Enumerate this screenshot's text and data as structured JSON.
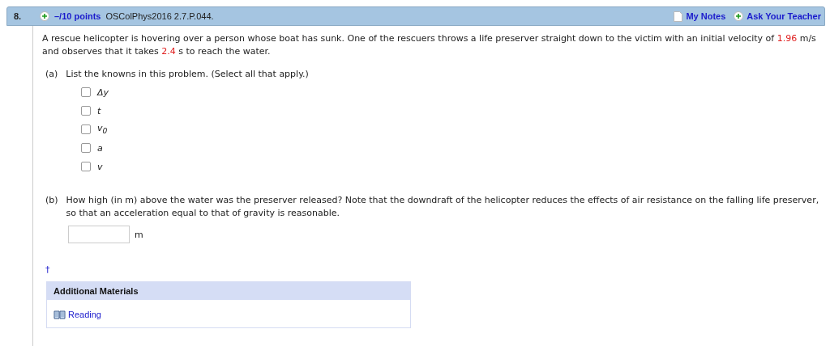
{
  "question": {
    "number": "8.",
    "points": "–/10 points",
    "source": "OSColPhys2016 2.7.P.044.",
    "notes_link": "My Notes",
    "ask_link": "Ask Your Teacher"
  },
  "prompt": [
    {
      "kind": "text",
      "text": "A rescue helicopter is hovering over a person whose boat has sunk. One of the rescuers throws a life preserver straight down to the victim with an initial velocity of "
    },
    {
      "kind": "value",
      "text": "1.96"
    },
    {
      "kind": "text",
      "text": " m/s and observes that it takes "
    },
    {
      "kind": "value",
      "text": "2.4"
    },
    {
      "kind": "text",
      "text": " s to reach the water."
    }
  ],
  "part_a": {
    "label": "(a)",
    "text": "List the knowns in this problem. (Select all that apply.)",
    "options": [
      {
        "label": "Δy",
        "checked": false
      },
      {
        "label": "t",
        "checked": false
      },
      {
        "label": "v$_{0}$",
        "checked": false
      },
      {
        "label": "a",
        "checked": false
      },
      {
        "label": "v",
        "checked": false
      }
    ]
  },
  "part_b": {
    "label": "(b)",
    "text": "How high (in m) above the water was the preserver released? Note that the downdraft of the helicopter reduces the effects of air resistance on the falling life preserver, so that an acceleration equal to that of gravity is reasonable.",
    "unit": "m"
  },
  "dagger": "†",
  "additional": {
    "title": "Additional Materials",
    "link": "Reading"
  }
}
